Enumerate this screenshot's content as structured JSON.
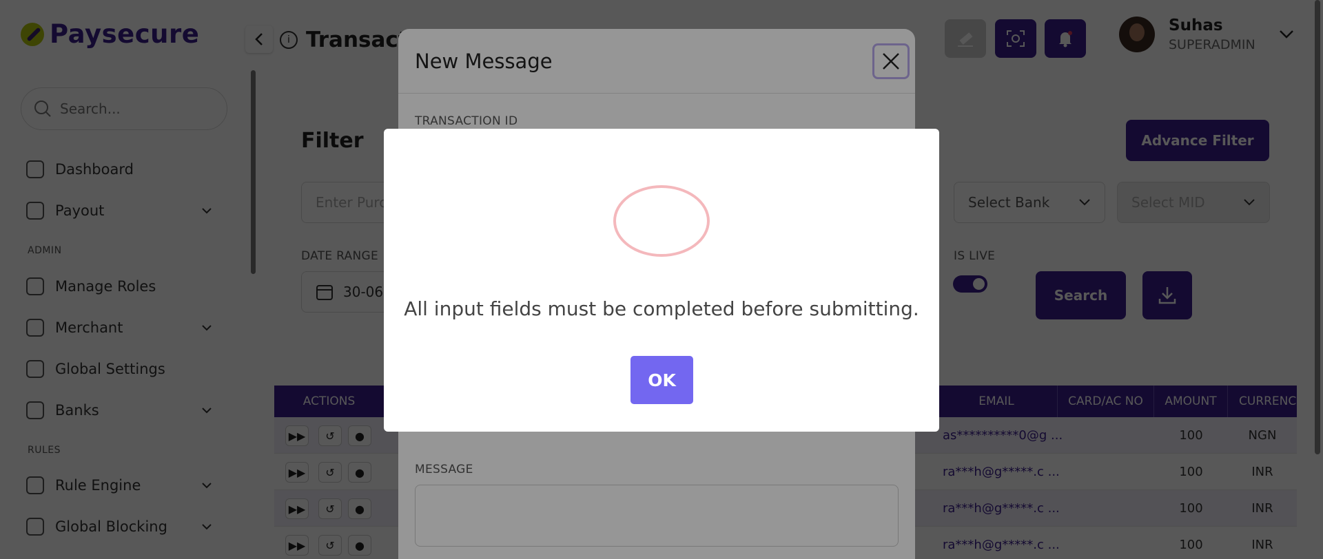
{
  "brand": {
    "name": "Paysecure"
  },
  "sidebar": {
    "search_placeholder": "Search...",
    "items": [
      {
        "label": "Dashboard"
      },
      {
        "label": "Payout"
      },
      {
        "section": "ADMIN"
      },
      {
        "label": "Manage Roles"
      },
      {
        "label": "Merchant"
      },
      {
        "label": "Global Settings"
      },
      {
        "label": "Banks"
      },
      {
        "section": "RULES"
      },
      {
        "label": "Rule Engine"
      },
      {
        "label": "Global Blocking"
      }
    ]
  },
  "header": {
    "title": "Transacti",
    "user_name": "Suhas",
    "user_role": "SUPERADMIN"
  },
  "filter": {
    "title": "Filter",
    "advance_label": "Advance Filter",
    "purchase_placeholder": "Enter Purc",
    "bank_label": "Select Bank",
    "mid_label": "Select MID",
    "date_range_label": "DATE RANGE",
    "date_value": "30-06",
    "is_live_label": "IS LIVE",
    "is_live": true,
    "search_label": "Search"
  },
  "table": {
    "headers": {
      "actions": "ACTIONS",
      "email": "EMAIL",
      "card": "CARD/AC NO",
      "amount": "AMOUNT",
      "currency": "CURRENC"
    },
    "rows": [
      {
        "email": "as**********0@g ...",
        "amount": "100",
        "currency": "NGN"
      },
      {
        "email": "ra***h@g*****.c ...",
        "amount": "100",
        "currency": "INR"
      },
      {
        "email": "ra***h@g*****.c ...",
        "amount": "100",
        "currency": "INR"
      },
      {
        "email": "ra***h@g*****.c ...",
        "amount": "100",
        "currency": "INR"
      }
    ]
  },
  "message_modal": {
    "title": "New Message",
    "transaction_id_label": "TRANSACTION ID",
    "message_label": "MESSAGE"
  },
  "alert": {
    "text": "All input fields must be completed before submitting.",
    "ok_label": "OK"
  },
  "colors": {
    "brand": "#3b1d8f",
    "ok_button": "#7367f0",
    "ring": "#f4b8bc"
  }
}
